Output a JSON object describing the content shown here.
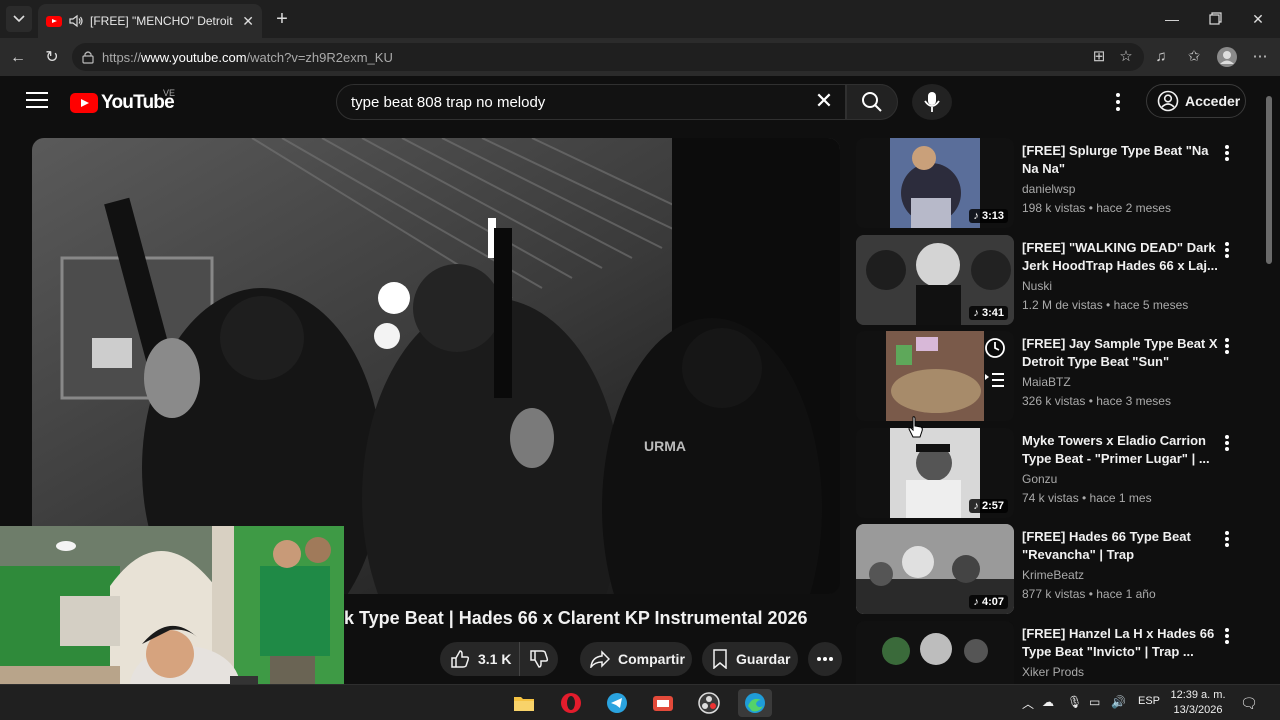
{
  "browser": {
    "tab_title": "[FREE] \"MENCHO\" Detroit Sar",
    "url_prefix": "https://",
    "url_host": "www.youtube.com",
    "url_path": "/watch?v=zh9R2exm_KU"
  },
  "youtube": {
    "logo_text": "YouTube",
    "country_code": "VE",
    "search_query": "type beat 808 trap no melody",
    "signin_label": "Acceder"
  },
  "player": {
    "title_visible": "k Type Beat | Hades 66 x Clarent KP Instrumental 2026",
    "likes": "3.1 K",
    "share_label": "Compartir",
    "save_label": "Guardar"
  },
  "recommendations": [
    {
      "title": "[FREE] Splurge Type Beat \"Na Na Na\"",
      "channel": "danielwsp",
      "meta": "198 k vistas • hace 2 meses",
      "duration": "3:13"
    },
    {
      "title": "[FREE] \"WALKING DEAD\" Dark Jerk HoodTrap Hades 66 x Laj...",
      "channel": "Nuski",
      "meta": "1.2 M de vistas • hace 5 meses",
      "duration": "3:41"
    },
    {
      "title": "[FREE] Jay Sample Type Beat X Detroit Type Beat \"Sun\"",
      "channel": "MaiaBTZ",
      "meta": "326 k vistas • hace 3 meses",
      "duration": ""
    },
    {
      "title": "Myke Towers x Eladio Carrion Type Beat - \"Primer Lugar\" | ...",
      "channel": "Gonzu",
      "meta": "74 k vistas • hace 1 mes",
      "duration": "2:57"
    },
    {
      "title": "[FREE] Hades 66 Type Beat \"Revancha\" | Trap Instrumental...",
      "channel": "KrimeBeatz",
      "meta": "877 k vistas • hace 1 año",
      "duration": "4:07"
    },
    {
      "title": "[FREE] Hanzel La H x Hades 66 Type Beat \"Invicto\" | Trap ...",
      "channel": "Xiker Prods",
      "meta": "",
      "duration": ""
    }
  ],
  "taskbar": {
    "language": "ESP",
    "time": "12:39 a. m.",
    "date": "13/3/2026"
  }
}
